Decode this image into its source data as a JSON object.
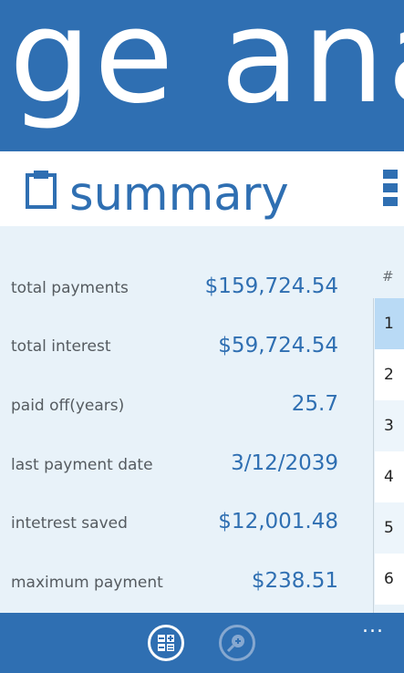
{
  "header": {
    "title": "ge ana"
  },
  "section": {
    "title": "summary"
  },
  "summary": {
    "rows": [
      {
        "label": "total payments",
        "value": "$159,724.54"
      },
      {
        "label": "total interest",
        "value": "$59,724.54"
      },
      {
        "label": "paid off(years)",
        "value": "25.7"
      },
      {
        "label": "last payment date",
        "value": "3/12/2039"
      },
      {
        "label": "intetrest saved",
        "value": "$12,001.48"
      },
      {
        "label": "maximum payment",
        "value": "$238.51"
      }
    ]
  },
  "schedule": {
    "header": "#",
    "rows": [
      "1",
      "2",
      "3",
      "4",
      "5",
      "6"
    ]
  },
  "appbar": {
    "buttons": [
      {
        "name": "calculator-button",
        "icon": "calculator-icon"
      },
      {
        "name": "zoom-in-button",
        "icon": "zoom-in-icon"
      }
    ],
    "more": "..."
  },
  "colors": {
    "accent": "#2f6fb2",
    "background": "#e8f2f9",
    "selected_row": "#b9daf5"
  }
}
